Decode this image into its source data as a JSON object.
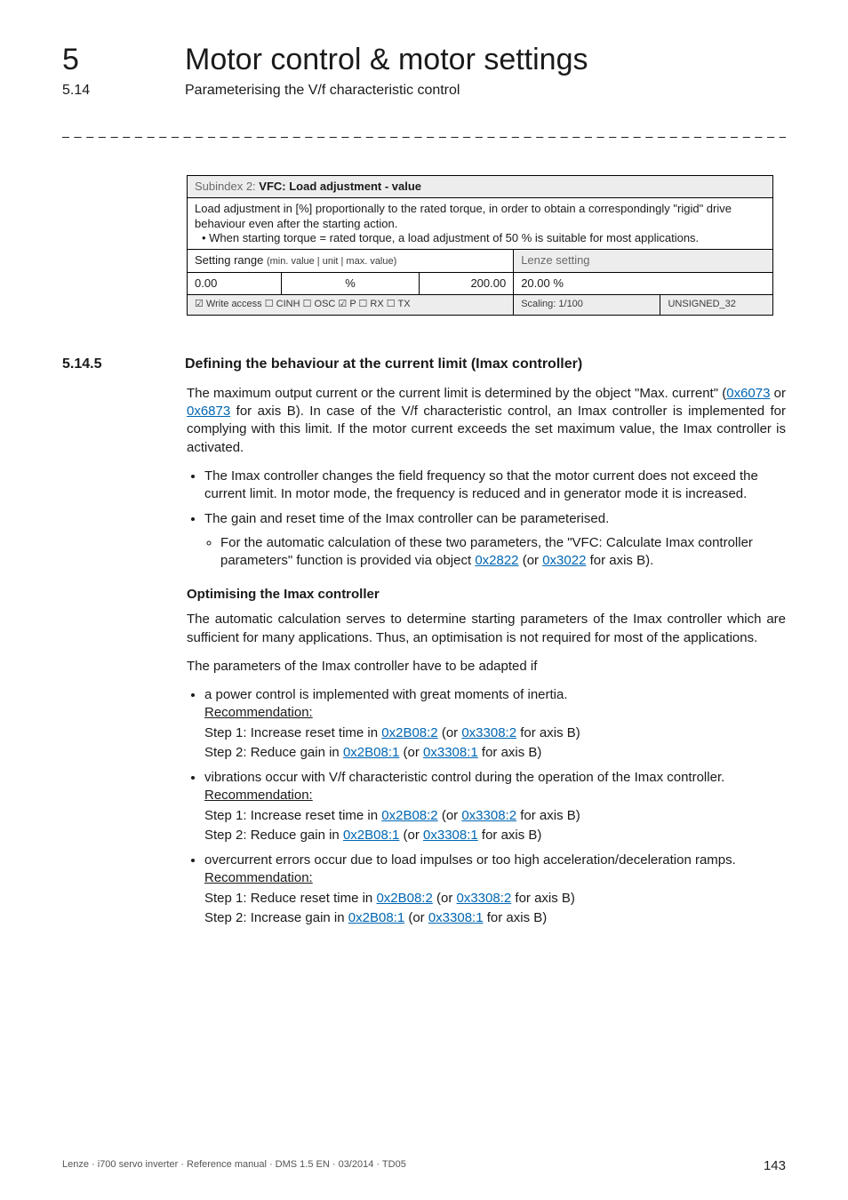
{
  "header": {
    "chapter_num": "5",
    "chapter_title": "Motor control & motor settings",
    "sub_num": "5.14",
    "sub_title": "Parameterising the V/f characteristic control"
  },
  "dash_rule": "_ _ _ _ _ _ _ _ _ _ _ _ _ _ _ _ _ _ _ _ _ _ _ _ _ _ _ _ _ _ _ _ _ _ _ _ _ _ _ _ _ _ _ _ _ _ _ _ _ _ _ _ _ _ _ _ _ _ _ _ _ _ _ _",
  "table": {
    "header_prefix": "Subindex 2: ",
    "header_bold": "VFC: Load adjustment - value",
    "desc_line1": "Load adjustment in [%] proportionally to the rated torque, in order to obtain a correspondingly \"rigid\" drive behaviour even after the starting action.",
    "desc_bullet": "• When starting torque = rated torque, a load adjustment of 50 % is suitable for most applications.",
    "setting_label_main": "Setting range ",
    "setting_label_small": "(min. value | unit | max. value)",
    "lenze_label": "Lenze setting",
    "row": {
      "min": "0.00",
      "unit": "%",
      "max": "200.00",
      "lenze": "20.00 %"
    },
    "footer_left": "☑ Write access   ☐ CINH   ☐ OSC   ☑ P   ☐ RX   ☐ TX",
    "footer_scaling": "Scaling: 1/100",
    "footer_type": "UNSIGNED_32"
  },
  "section": {
    "num": "5.14.5",
    "title": "Defining the behaviour at the current limit (Imax controller)"
  },
  "para1a": "The maximum output current or the current limit is determined by the object \"Max. current\" (",
  "link_6073": "0x6073",
  "para1b": " or ",
  "link_6873": "0x6873",
  "para1c": " for axis B). In case of the V/f characteristic control, an Imax controller is implemented for complying with this limit. If the motor current exceeds the set maximum value, the Imax controller is activated.",
  "bullets1": {
    "b1": "The Imax controller changes the field frequency so that the motor current does not exceed the current limit. In motor mode, the frequency is reduced and in generator mode it is increased.",
    "b2": "The gain and reset time of the Imax controller can be parameterised.",
    "b2_sub_a": "For the automatic calculation of these two parameters, the \"VFC: Calculate Imax controller parameters\" function is provided via object ",
    "link_2822": "0x2822",
    "b2_sub_b": " (or ",
    "link_3022": "0x3022",
    "b2_sub_c": " for axis B)."
  },
  "opt_head": "Optimising the Imax controller",
  "opt_p1": "The automatic calculation serves to determine starting parameters of the Imax controller which are sufficient for many applications. Thus, an optimisation is not required for most of the applications.",
  "opt_p2": "The parameters of the Imax controller have to be adapted if",
  "cases": [
    {
      "lead": "a power control is implemented with great moments of inertia.",
      "rec": "Recommendation:",
      "step1a": "Step 1: Increase reset time in ",
      "link1a": "0x2B08:2",
      "link1b": "0x3308:2",
      "step1c": " for axis B)",
      "step2a": "Step 2: Reduce gain in ",
      "link2a": "0x2B08:1",
      "link2b": "0x3308:1",
      "step2c": " for axis B)"
    },
    {
      "lead": "vibrations occur with V/f characteristic control during the operation of the Imax controller.",
      "rec": "Recommendation:",
      "step1a": "Step 1: Increase reset time in ",
      "link1a": "0x2B08:2",
      "link1b": "0x3308:2",
      "step1c": " for axis B)",
      "step2a": "Step 2: Reduce gain in ",
      "link2a": "0x2B08:1",
      "link2b": "0x3308:1",
      "step2c": " for axis B)"
    },
    {
      "lead": "overcurrent errors occur due to load impulses or too high acceleration/deceleration ramps.",
      "rec": "Recommendation:",
      "step1a": "Step 1: Reduce reset time in ",
      "link1a": "0x2B08:2",
      "link1b": "0x3308:2",
      "step1c": " for axis B)",
      "step2a": "Step 2: Increase gain in ",
      "link2a": "0x2B08:1",
      "link2b": "0x3308:1",
      "step2c": " for axis B)"
    }
  ],
  "or_open": " (or ",
  "footer": {
    "left": "Lenze · i700 servo inverter · Reference manual · DMS 1.5 EN · 03/2014 · TD05",
    "page": "143"
  }
}
